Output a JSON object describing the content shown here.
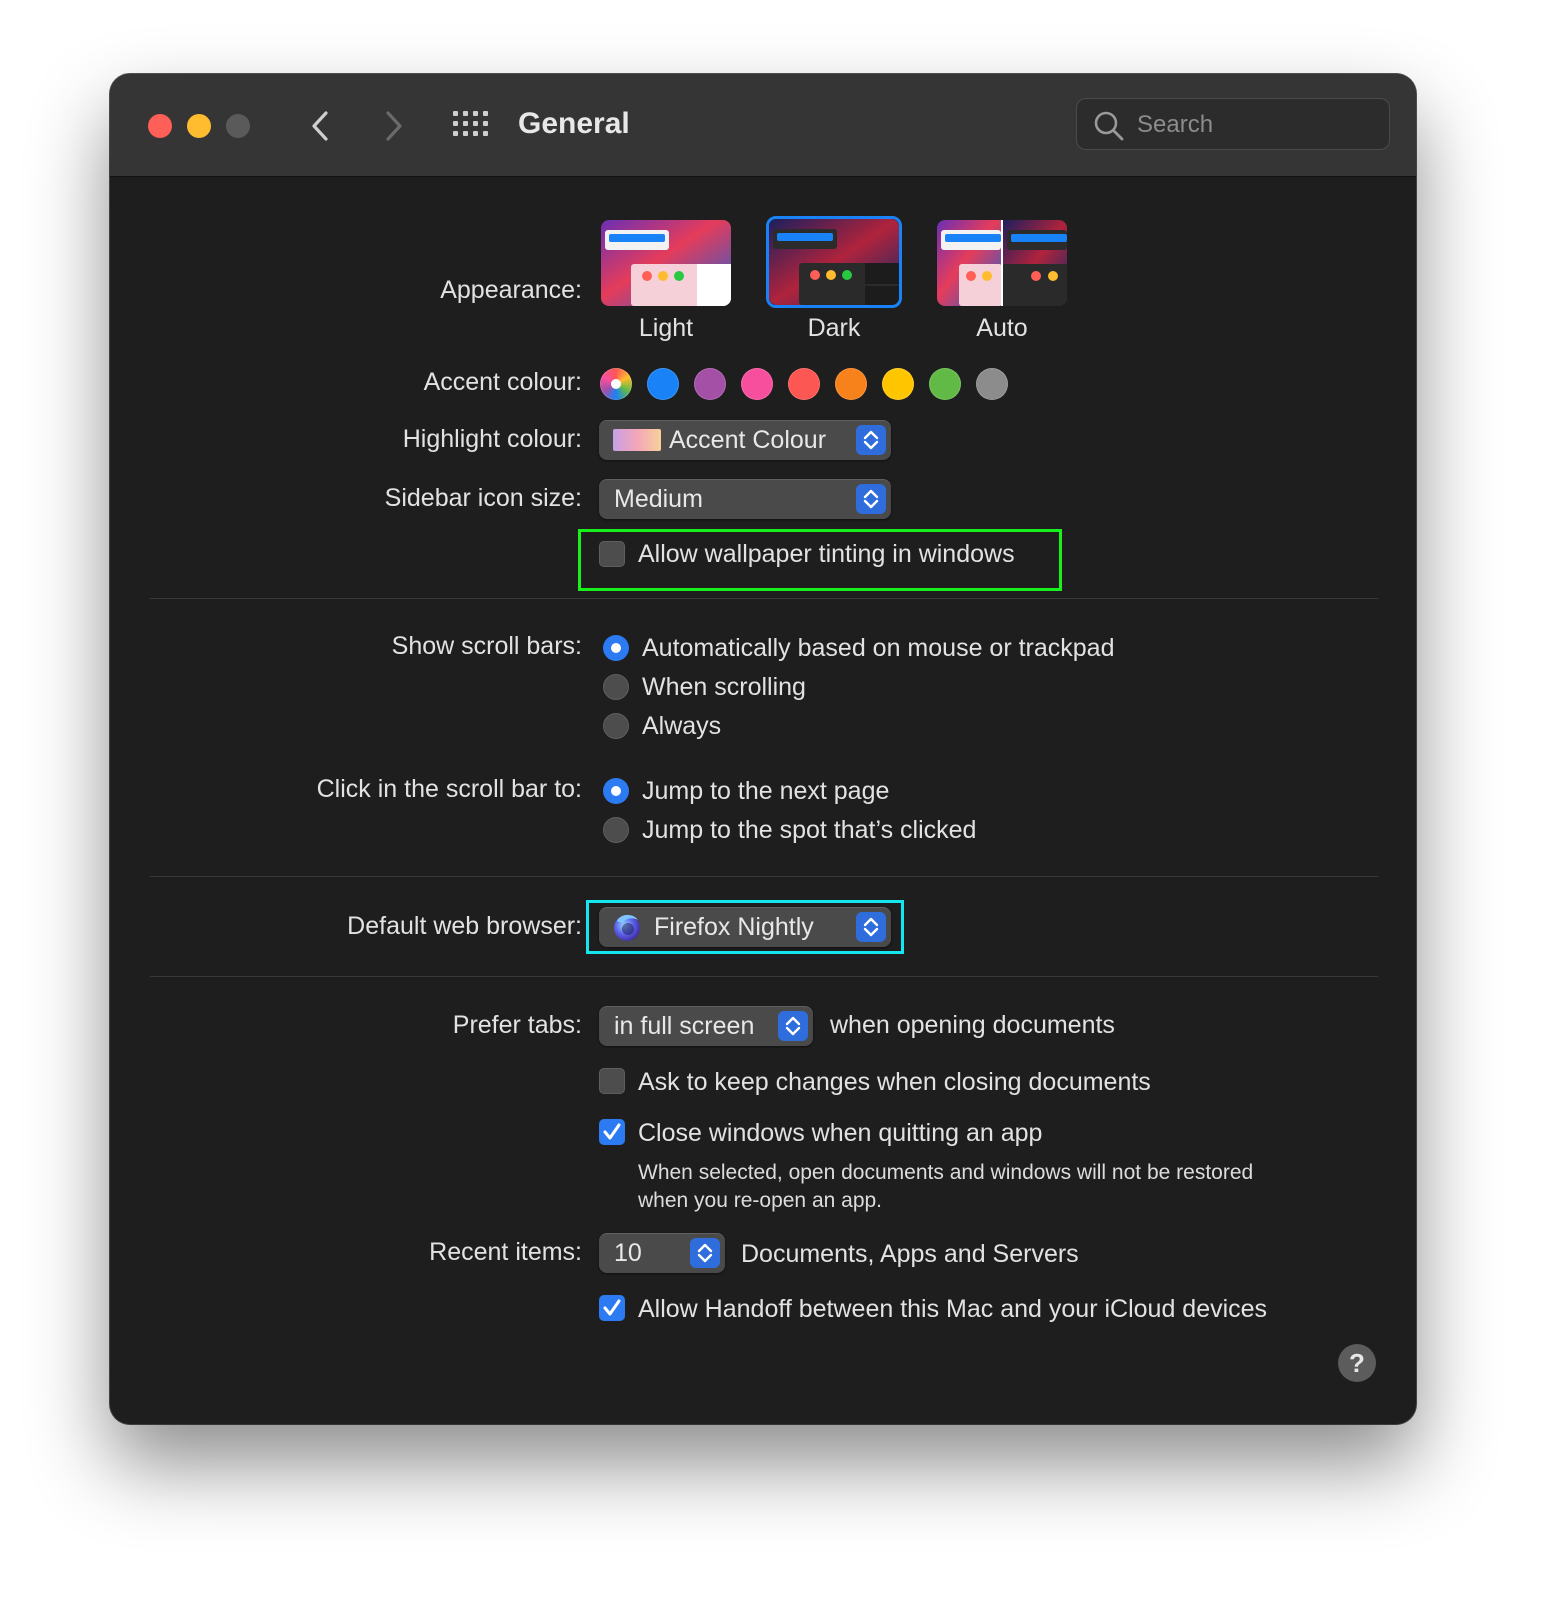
{
  "window": {
    "title": "General",
    "search_placeholder": "Search"
  },
  "appearance": {
    "label": "Appearance:",
    "options": [
      "Light",
      "Dark",
      "Auto"
    ],
    "selected": "Dark"
  },
  "accent": {
    "label": "Accent colour:",
    "colors": [
      "multicolor",
      "#1a82f7",
      "#a550a7",
      "#f74f9e",
      "#fc5753",
      "#f7821b",
      "#ffc600",
      "#62ba46",
      "#8c8c8c"
    ],
    "selected_index": 0
  },
  "highlight": {
    "label": "Highlight colour:",
    "value": "Accent Colour"
  },
  "sidebar_icon": {
    "label": "Sidebar icon size:",
    "value": "Medium"
  },
  "wallpaper_tinting": {
    "label": "Allow wallpaper tinting in windows",
    "checked": false
  },
  "scroll_bars": {
    "label": "Show scroll bars:",
    "options": [
      "Automatically based on mouse or trackpad",
      "When scrolling",
      "Always"
    ],
    "selected_index": 0
  },
  "scroll_click": {
    "label": "Click in the scroll bar to:",
    "options": [
      "Jump to the next page",
      "Jump to the spot that’s clicked"
    ],
    "selected_index": 0
  },
  "browser": {
    "label": "Default web browser:",
    "value": "Firefox Nightly"
  },
  "prefer_tabs": {
    "label": "Prefer tabs:",
    "value": "in full screen",
    "suffix": "when opening documents"
  },
  "ask_keep_changes": {
    "label": "Ask to keep changes when closing documents",
    "checked": false
  },
  "close_windows": {
    "label": "Close windows when quitting an app",
    "checked": true,
    "note_line1": "When selected, open documents and windows will not be restored",
    "note_line2": "when you re-open an app."
  },
  "recent_items": {
    "label": "Recent items:",
    "value": "10",
    "suffix": "Documents, Apps and Servers"
  },
  "handoff": {
    "label": "Allow Handoff between this Mac and your iCloud devices",
    "checked": true
  },
  "help": {
    "label": "?"
  },
  "annotations": {
    "green_box_color": "#17f01a",
    "cyan_box_color": "#14e6ef"
  }
}
